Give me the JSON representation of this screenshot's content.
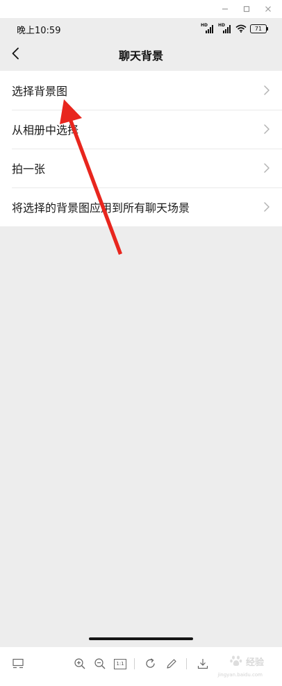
{
  "window_controls": {
    "minimize": "—",
    "maximize": "□",
    "close": "✕"
  },
  "status_bar": {
    "time": "晚上10:59",
    "signal_1_label": "HD",
    "signal_2_label": "HD",
    "battery": "71"
  },
  "nav": {
    "title": "聊天背景"
  },
  "menu": {
    "items": [
      {
        "label": "选择背景图"
      },
      {
        "label": "从相册中选择"
      },
      {
        "label": "拍一张"
      },
      {
        "label": "将选择的背景图应用到所有聊天场景"
      }
    ]
  },
  "annotation": {
    "color": "#e8261e",
    "points_to": "选择背景图"
  },
  "toolbar": {
    "actual_size_label": "1:1",
    "watermark": "经验",
    "watermark_sub": "jingyan.baidu.com"
  },
  "colors": {
    "page_background": "#ededed",
    "list_background": "#ffffff",
    "text": "#1a1a1a",
    "chevron": "#b3b3b3"
  }
}
